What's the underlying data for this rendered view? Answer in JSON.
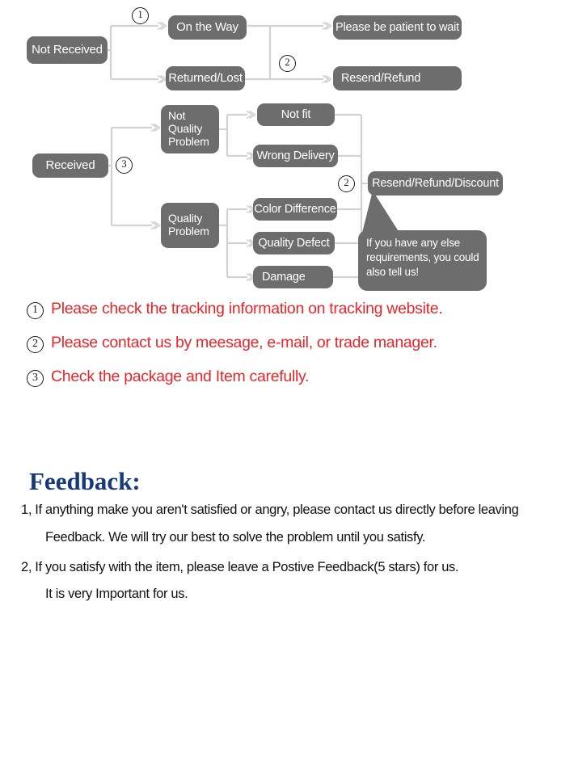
{
  "flowchart": {
    "title": "Order problem resolution flowchart",
    "colors": {
      "node_fill": "#6d6d6d",
      "node_text": "#ffffff",
      "wire": "#d2d2d2",
      "note_text": "#e8262a",
      "heading": "#18387a"
    },
    "nodes": {
      "not_received": "Not Received",
      "on_the_way": "On the Way",
      "returned_lost": "Returned/Lost",
      "please_wait": "Please be patient to wait",
      "resend_refund": "Resend/Refund",
      "received": "Received",
      "not_quality_problem": "Not\nQuality\nProblem",
      "quality_problem": "Quality\nProblem",
      "not_fit": "Not fit",
      "wrong_delivery": "Wrong Delivery",
      "color_difference": "Color Difference",
      "quality_defect": "Quality Defect",
      "damage": "Damage",
      "resend_refund_discount": "Resend/Refund/Discount"
    },
    "markers": {
      "m1": "1",
      "m2": "2",
      "m3": "3",
      "m4": "2"
    },
    "bubble": "If you have any else\nrequirements, you could\nalso tell us!"
  },
  "notes": [
    {
      "num": "1",
      "text": "Please check the tracking information on tracking website."
    },
    {
      "num": "2",
      "text": "Please contact us by meesage, e-mail, or trade manager."
    },
    {
      "num": "3",
      "text": "Check the package and Item carefully."
    }
  ],
  "feedback": {
    "title": "Feedback:",
    "lines": [
      "1, If anything make you aren't satisfied or angry, please contact us directly before leaving",
      "Feedback. We will try our best to solve the problem until you satisfy.",
      "2, If you satisfy with the item, please leave a Postive Feedback(5 stars) for us.",
      "It is very Important for us."
    ]
  }
}
